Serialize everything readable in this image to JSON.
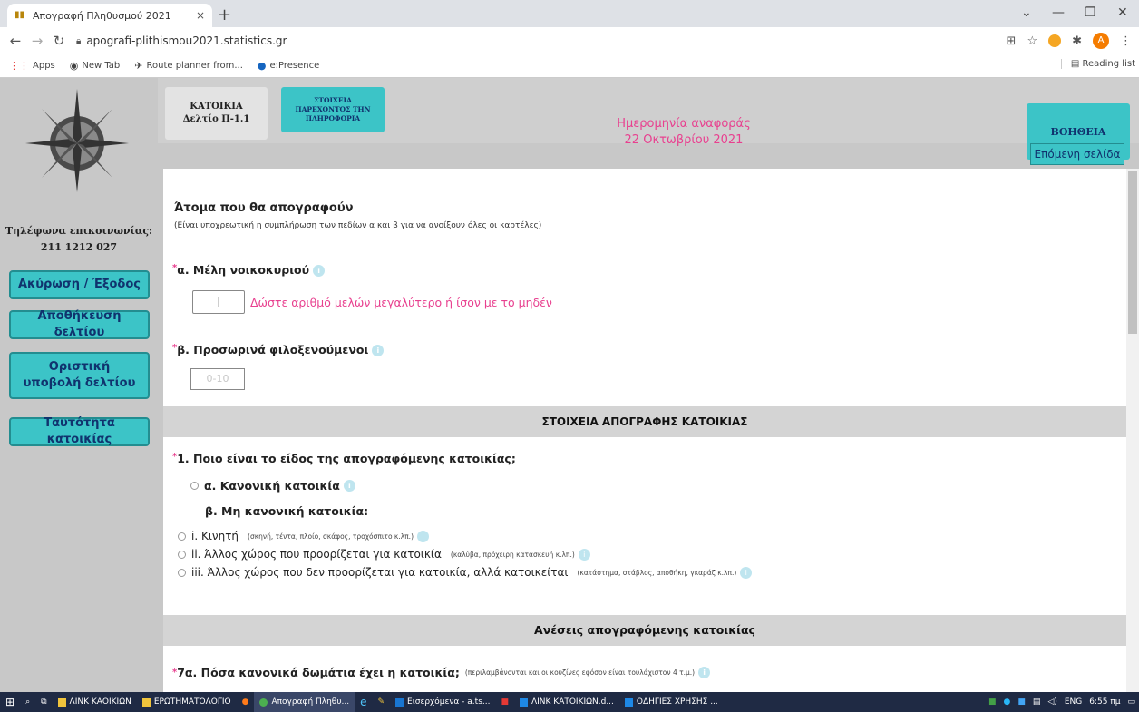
{
  "browser": {
    "tab_title": "Απογραφή Πληθυσμού 2021",
    "tab_close": "×",
    "new_tab": "+",
    "url": "apografi-plithismou2021.statistics.gr",
    "bookmarks": [
      "Apps",
      "New Tab",
      "Route planner from...",
      "e:Presence"
    ],
    "reading_list": "Reading list",
    "avatar_letter": "A"
  },
  "sidebar": {
    "phone_label": "Τηλέφωνα επικοινωνίας:",
    "phone_number": "211 1212 027",
    "buttons": [
      "Ακύρωση / Έξοδος",
      "Αποθήκευση δελτίου",
      "Οριστική υποβολή δελτίου",
      "Ταυτότητα κατοικίας"
    ]
  },
  "header": {
    "box1_line1": "ΚΑΤΟΙΚΙΑ",
    "box1_line2": "Δελτίο Π-1.1",
    "box2": "ΣΤΟΙΧΕΙΑ ΠΑΡΕΧΟΝΤΟΣ ΤΗΝ ΠΛΗΡΟΦΟΡΙΑ",
    "date_label": "Ημερομηνία αναφοράς",
    "date_value": "22 Οκτωβρίου 2021",
    "help": "ΒΟΗΘΕΙΑ",
    "next_page": "Επόμενη σελίδα"
  },
  "form": {
    "section_title": "Άτομα που θα απογραφούν",
    "section_note": "(Είναι υποχρεωτική η συμπλήρωση των πεδίων α και β για να ανοίξουν όλες οι καρτέλες)",
    "qa_label": "α. Μέλη νοικοκυριού",
    "qa_value": "|",
    "qa_error": "Δώστε αριθμό μελών μεγαλύτερο ή ίσον με το μηδέν",
    "qb_label": "β. Προσωρινά φιλοξενούμενοι",
    "qb_placeholder": "0-10",
    "band1": "ΣΤΟΙΧΕΙΑ ΑΠΟΓΡΑΦΗΣ ΚΑΤΟΙΚΙΑΣ",
    "q1": "1. Ποιο είναι το είδος της απογραφόμενης κατοικίας;",
    "opt_a": "α. Κανονική κατοικία",
    "sub_b": "β. Μη κανονική κατοικία:",
    "opt_i": "i. Κινητή",
    "opt_i_note": "(σκηνή, τέντα, πλοίο, σκάφος, τροχόσπιτο κ.λπ.)",
    "opt_ii": "ii. Άλλος χώρος που προορίζεται για κατοικία",
    "opt_ii_note": "(καλύβα, πρόχειρη κατασκευή κ.λπ.)",
    "opt_iii": "iii. Άλλος χώρος που δεν προορίζεται για κατοικία, αλλά κατοικείται",
    "opt_iii_note": "(κατάστημα, στάβλος, αποθήκη, γκαράζ κ.λπ.)",
    "band2": "Ανέσεις απογραφόμενης κατοικίας",
    "q7a": "7α. Πόσα κανονικά δωμάτια έχει η κατοικία;",
    "q7a_note": "(περιλαμβάνονται και οι κουζίνες εφόσον είναι τουλάχιστον 4 τ.μ.)"
  },
  "taskbar": {
    "items": [
      "ΛΙΝΚ ΚΑΟΙΚΙΩΝ",
      "ΕΡΩΤΗΜΑΤΟΛΟΓΙΟ",
      "Απογραφή Πληθυ...",
      "Εισερχόμενα - a.ts...",
      "ΛΙΝΚ ΚΑΤΟΙΚΙΩΝ.d...",
      "ΟΔΗΓΙΕΣ ΧΡΗΣΗΣ ..."
    ],
    "lang": "ENG",
    "time": "6:55 πμ"
  }
}
